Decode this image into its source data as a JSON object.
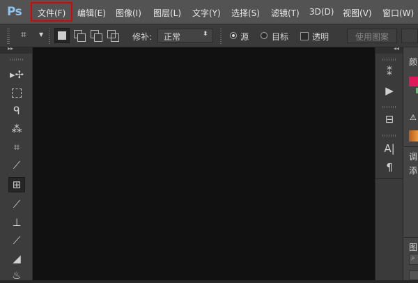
{
  "app": {
    "logo": "Ps"
  },
  "menu": {
    "file": "文件(F)",
    "edit": "编辑(E)",
    "image": "图像(I)",
    "layer": "图层(L)",
    "type": "文字(Y)",
    "select": "选择(S)",
    "filter": "滤镜(T)",
    "threed": "3D(D)",
    "view": "视图(V)",
    "window": "窗口(W)"
  },
  "options": {
    "patch_label": "修补:",
    "patch_value": "正常",
    "source_label": "源",
    "target_label": "目标",
    "transparent_label": "透明",
    "use_pattern_label": "使用图案"
  },
  "panels": {
    "color_tab": "颜",
    "adjust_tab": "调",
    "add_text": "添",
    "layers_tab": "图"
  },
  "colors": {
    "foreground": "#e0185a",
    "highlight_box": "#e00000",
    "logo": "#8fc4ef"
  },
  "icons": {
    "tools": [
      "move-icon",
      "marquee-icon",
      "lasso-icon",
      "magic-wand-icon",
      "crop-icon",
      "eyedropper-icon",
      "patch-icon",
      "brush-icon",
      "stamp-icon",
      "history-brush-icon",
      "eraser-icon",
      "paint-bucket-icon"
    ],
    "dock": [
      "history-icon",
      "actions-play-icon",
      "properties-icon",
      "character-icon",
      "paragraph-icon"
    ]
  }
}
